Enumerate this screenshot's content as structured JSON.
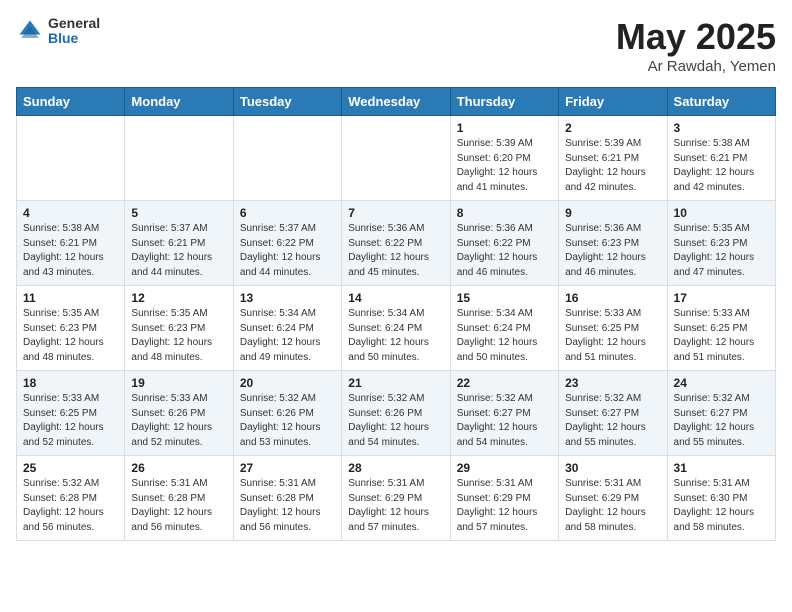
{
  "header": {
    "logo_general": "General",
    "logo_blue": "Blue",
    "title": "May 2025",
    "location": "Ar Rawdah, Yemen"
  },
  "weekdays": [
    "Sunday",
    "Monday",
    "Tuesday",
    "Wednesday",
    "Thursday",
    "Friday",
    "Saturday"
  ],
  "weeks": [
    [
      {
        "day": "",
        "info": ""
      },
      {
        "day": "",
        "info": ""
      },
      {
        "day": "",
        "info": ""
      },
      {
        "day": "",
        "info": ""
      },
      {
        "day": "1",
        "info": "Sunrise: 5:39 AM\nSunset: 6:20 PM\nDaylight: 12 hours\nand 41 minutes."
      },
      {
        "day": "2",
        "info": "Sunrise: 5:39 AM\nSunset: 6:21 PM\nDaylight: 12 hours\nand 42 minutes."
      },
      {
        "day": "3",
        "info": "Sunrise: 5:38 AM\nSunset: 6:21 PM\nDaylight: 12 hours\nand 42 minutes."
      }
    ],
    [
      {
        "day": "4",
        "info": "Sunrise: 5:38 AM\nSunset: 6:21 PM\nDaylight: 12 hours\nand 43 minutes."
      },
      {
        "day": "5",
        "info": "Sunrise: 5:37 AM\nSunset: 6:21 PM\nDaylight: 12 hours\nand 44 minutes."
      },
      {
        "day": "6",
        "info": "Sunrise: 5:37 AM\nSunset: 6:22 PM\nDaylight: 12 hours\nand 44 minutes."
      },
      {
        "day": "7",
        "info": "Sunrise: 5:36 AM\nSunset: 6:22 PM\nDaylight: 12 hours\nand 45 minutes."
      },
      {
        "day": "8",
        "info": "Sunrise: 5:36 AM\nSunset: 6:22 PM\nDaylight: 12 hours\nand 46 minutes."
      },
      {
        "day": "9",
        "info": "Sunrise: 5:36 AM\nSunset: 6:23 PM\nDaylight: 12 hours\nand 46 minutes."
      },
      {
        "day": "10",
        "info": "Sunrise: 5:35 AM\nSunset: 6:23 PM\nDaylight: 12 hours\nand 47 minutes."
      }
    ],
    [
      {
        "day": "11",
        "info": "Sunrise: 5:35 AM\nSunset: 6:23 PM\nDaylight: 12 hours\nand 48 minutes."
      },
      {
        "day": "12",
        "info": "Sunrise: 5:35 AM\nSunset: 6:23 PM\nDaylight: 12 hours\nand 48 minutes."
      },
      {
        "day": "13",
        "info": "Sunrise: 5:34 AM\nSunset: 6:24 PM\nDaylight: 12 hours\nand 49 minutes."
      },
      {
        "day": "14",
        "info": "Sunrise: 5:34 AM\nSunset: 6:24 PM\nDaylight: 12 hours\nand 50 minutes."
      },
      {
        "day": "15",
        "info": "Sunrise: 5:34 AM\nSunset: 6:24 PM\nDaylight: 12 hours\nand 50 minutes."
      },
      {
        "day": "16",
        "info": "Sunrise: 5:33 AM\nSunset: 6:25 PM\nDaylight: 12 hours\nand 51 minutes."
      },
      {
        "day": "17",
        "info": "Sunrise: 5:33 AM\nSunset: 6:25 PM\nDaylight: 12 hours\nand 51 minutes."
      }
    ],
    [
      {
        "day": "18",
        "info": "Sunrise: 5:33 AM\nSunset: 6:25 PM\nDaylight: 12 hours\nand 52 minutes."
      },
      {
        "day": "19",
        "info": "Sunrise: 5:33 AM\nSunset: 6:26 PM\nDaylight: 12 hours\nand 52 minutes."
      },
      {
        "day": "20",
        "info": "Sunrise: 5:32 AM\nSunset: 6:26 PM\nDaylight: 12 hours\nand 53 minutes."
      },
      {
        "day": "21",
        "info": "Sunrise: 5:32 AM\nSunset: 6:26 PM\nDaylight: 12 hours\nand 54 minutes."
      },
      {
        "day": "22",
        "info": "Sunrise: 5:32 AM\nSunset: 6:27 PM\nDaylight: 12 hours\nand 54 minutes."
      },
      {
        "day": "23",
        "info": "Sunrise: 5:32 AM\nSunset: 6:27 PM\nDaylight: 12 hours\nand 55 minutes."
      },
      {
        "day": "24",
        "info": "Sunrise: 5:32 AM\nSunset: 6:27 PM\nDaylight: 12 hours\nand 55 minutes."
      }
    ],
    [
      {
        "day": "25",
        "info": "Sunrise: 5:32 AM\nSunset: 6:28 PM\nDaylight: 12 hours\nand 56 minutes."
      },
      {
        "day": "26",
        "info": "Sunrise: 5:31 AM\nSunset: 6:28 PM\nDaylight: 12 hours\nand 56 minutes."
      },
      {
        "day": "27",
        "info": "Sunrise: 5:31 AM\nSunset: 6:28 PM\nDaylight: 12 hours\nand 56 minutes."
      },
      {
        "day": "28",
        "info": "Sunrise: 5:31 AM\nSunset: 6:29 PM\nDaylight: 12 hours\nand 57 minutes."
      },
      {
        "day": "29",
        "info": "Sunrise: 5:31 AM\nSunset: 6:29 PM\nDaylight: 12 hours\nand 57 minutes."
      },
      {
        "day": "30",
        "info": "Sunrise: 5:31 AM\nSunset: 6:29 PM\nDaylight: 12 hours\nand 58 minutes."
      },
      {
        "day": "31",
        "info": "Sunrise: 5:31 AM\nSunset: 6:30 PM\nDaylight: 12 hours\nand 58 minutes."
      }
    ]
  ]
}
